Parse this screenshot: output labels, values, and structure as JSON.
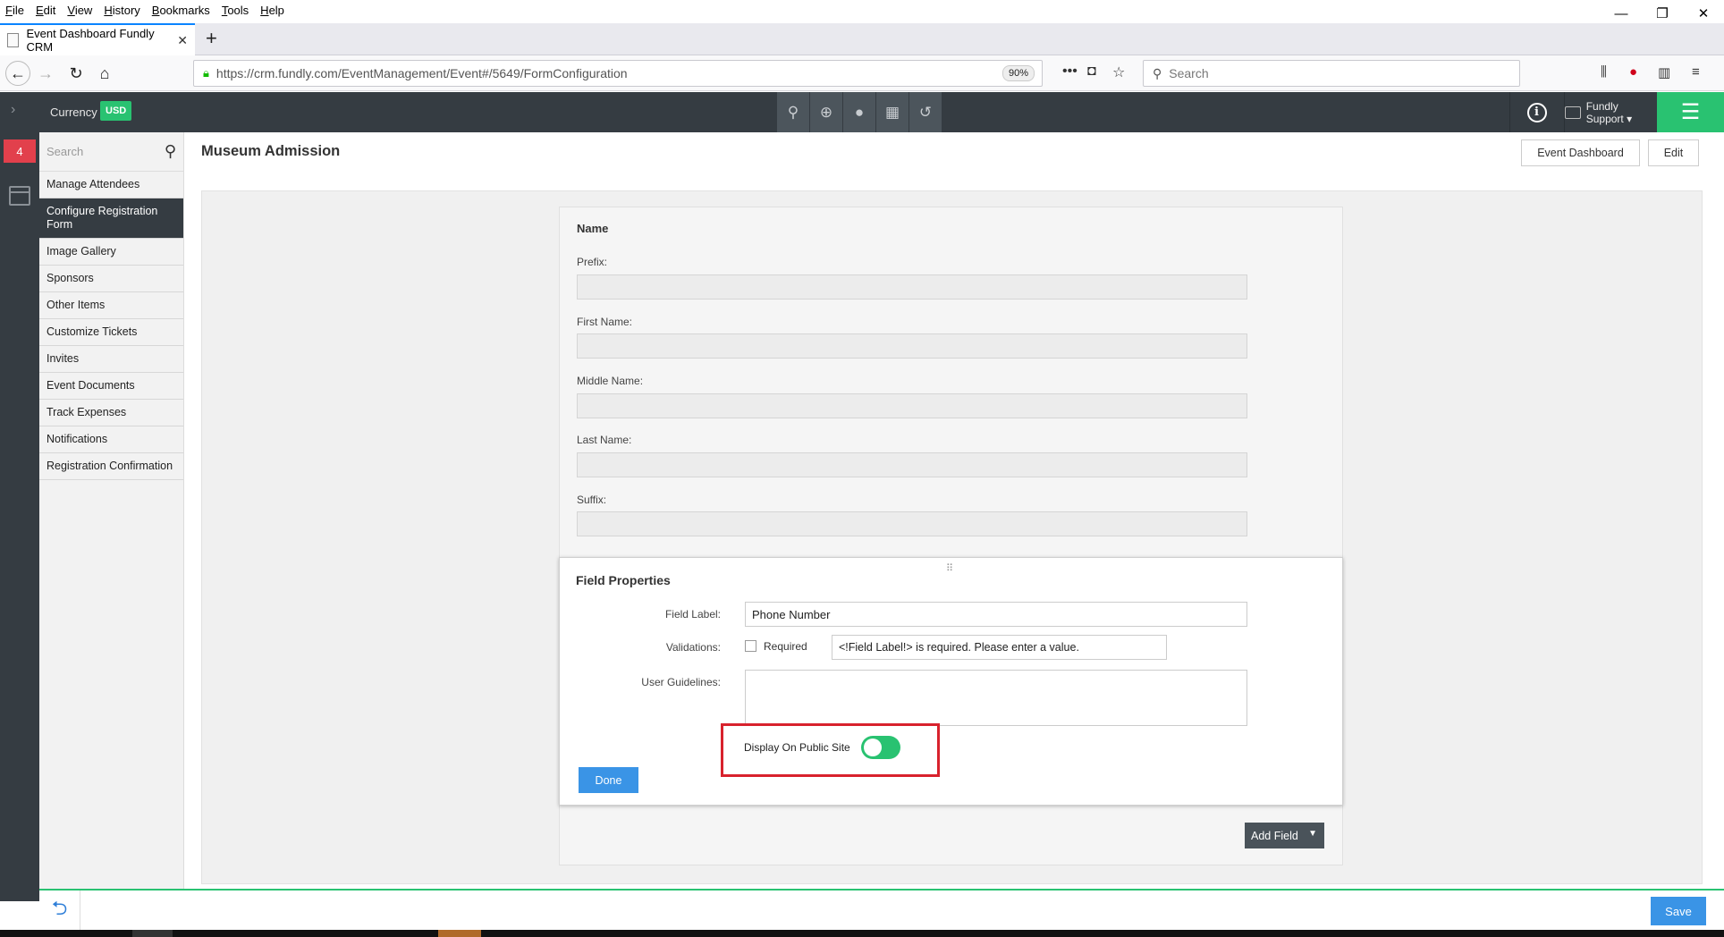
{
  "browser": {
    "menu": [
      "File",
      "Edit",
      "View",
      "History",
      "Bookmarks",
      "Tools",
      "Help"
    ],
    "window_controls": [
      "—",
      "❐",
      "✕"
    ],
    "tab_title": "Event Dashboard Fundly CRM",
    "tab_close": "✕",
    "new_tab": "+",
    "url": "https://crm.fundly.com/EventManagement/Event#/5649/FormConfiguration",
    "zoom": "90%",
    "url_more": "•••",
    "search_placeholder": "Search"
  },
  "appbar": {
    "currency_label": "Currency",
    "currency_value": "USD",
    "info": "i",
    "user_menu": "Fundly Support ▾",
    "accent": "#29c271"
  },
  "rail": {
    "badge_count": "4"
  },
  "sidebar": {
    "search_placeholder": "Search",
    "items": [
      {
        "label": "Manage Attendees"
      },
      {
        "label": "Configure Registration Form"
      },
      {
        "label": "Image Gallery"
      },
      {
        "label": "Sponsors"
      },
      {
        "label": "Other Items"
      },
      {
        "label": "Customize Tickets"
      },
      {
        "label": "Invites"
      },
      {
        "label": "Event Documents"
      },
      {
        "label": "Track Expenses"
      },
      {
        "label": "Notifications"
      },
      {
        "label": "Registration Confirmation"
      }
    ]
  },
  "header": {
    "title": "Museum Admission",
    "event_dashboard_btn": "Event Dashboard",
    "edit_btn": "Edit"
  },
  "form": {
    "section_title": "Name",
    "fields": [
      {
        "label": "Prefix:"
      },
      {
        "label": "First Name:"
      },
      {
        "label": "Middle Name:"
      },
      {
        "label": "Last Name:"
      },
      {
        "label": "Suffix:"
      }
    ]
  },
  "field_properties": {
    "title": "Field Properties",
    "grip": "⠿",
    "field_label_label": "Field Label:",
    "field_label_value": "Phone Number",
    "validations_label": "Validations:",
    "required_label": "Required",
    "required_message": "<!Field Label!> is required. Please enter a value.",
    "user_guidelines_label": "User Guidelines:",
    "display_public_label": "Display On Public Site",
    "done_label": "Done"
  },
  "add_field_label": "Add Field",
  "save_label": "Save"
}
